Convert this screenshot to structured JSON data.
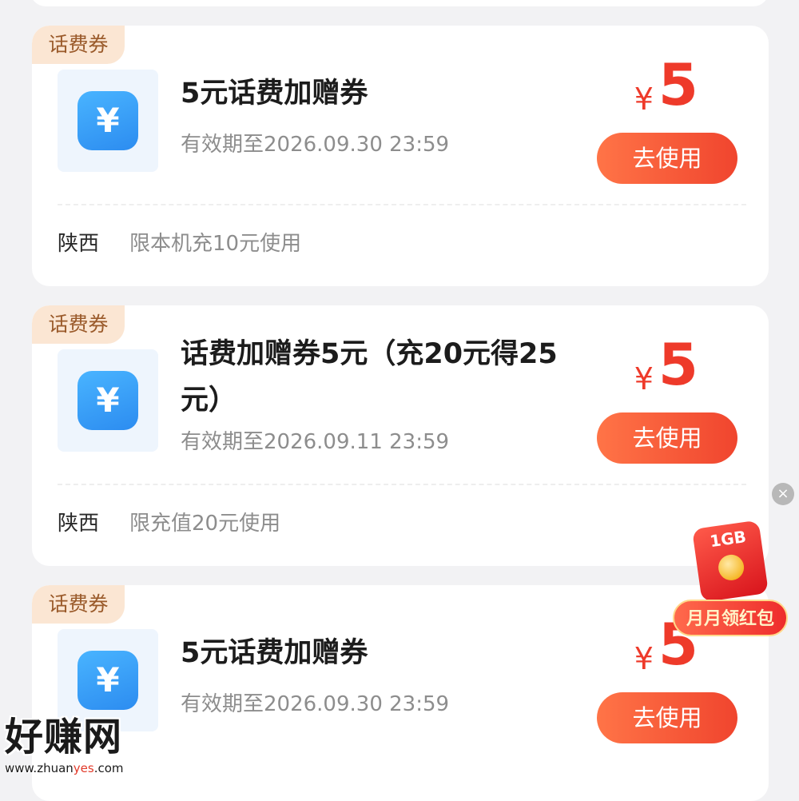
{
  "coupons": [
    {
      "tag": "话费券",
      "icon": "yen-icon",
      "icon_symbol": "¥",
      "title": "5元话费加赠券",
      "validity": "有效期至2026.09.30 23:59",
      "price_symbol": "¥",
      "price_value": "5",
      "button_label": "去使用",
      "region": "陕西",
      "rule": "限本机充10元使用"
    },
    {
      "tag": "话费券",
      "icon": "yen-icon",
      "icon_symbol": "¥",
      "title": "话费加赠券5元（充20元得25元）",
      "validity": "有效期至2026.09.11 23:59",
      "price_symbol": "¥",
      "price_value": "5",
      "button_label": "去使用",
      "region": "陕西",
      "rule": "限充值20元使用"
    },
    {
      "tag": "话费券",
      "icon": "yen-icon",
      "icon_symbol": "¥",
      "title": "5元话费加赠券",
      "validity": "有效期至2026.09.30 23:59",
      "price_symbol": "¥",
      "price_value": "5",
      "button_label": "去使用"
    }
  ],
  "floating_promo": {
    "close_symbol": "×",
    "data_label": "1GB",
    "label": "月月领红包"
  },
  "watermark": {
    "title": "好赚网",
    "url_prefix": "www.zhuan",
    "url_accent": "yes",
    "url_suffix": ".com"
  },
  "colors": {
    "accent": "#ee3a2a",
    "button_start": "#ff7447",
    "button_end": "#f0452e",
    "tag_bg": "#fbe6d3",
    "icon_blue": "#2c8cf0"
  }
}
